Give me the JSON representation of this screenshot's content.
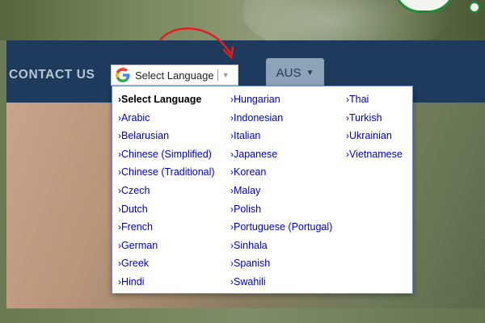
{
  "nav": {
    "contact_label": "CONTACT US",
    "region_label": "AUS",
    "region_caret": "▼"
  },
  "translate": {
    "label": "Select Language",
    "arrow": "▼"
  },
  "language_menu": {
    "chevron": "›",
    "columns": [
      [
        "Select Language",
        "Arabic",
        "Belarusian",
        "Chinese (Simplified)",
        "Chinese (Traditional)",
        "Czech",
        "Dutch",
        "French",
        "German",
        "Greek",
        "Hindi"
      ],
      [
        "Hungarian",
        "Indonesian",
        "Italian",
        "Japanese",
        "Korean",
        "Malay",
        "Polish",
        "Portuguese (Portugal)",
        "Sinhala",
        "Spanish",
        "Swahili"
      ],
      [
        "Thai",
        "Turkish",
        "Ukrainian",
        "Vietnamese"
      ]
    ]
  },
  "colors": {
    "nav_bg": "#1e3a5c",
    "link": "#0000cc",
    "annotation_arrow": "#e02020",
    "region_button_bg": "#8da3b8"
  },
  "icons": {
    "translate": "google-g-icon",
    "annotation": "curved-arrow-icon"
  }
}
